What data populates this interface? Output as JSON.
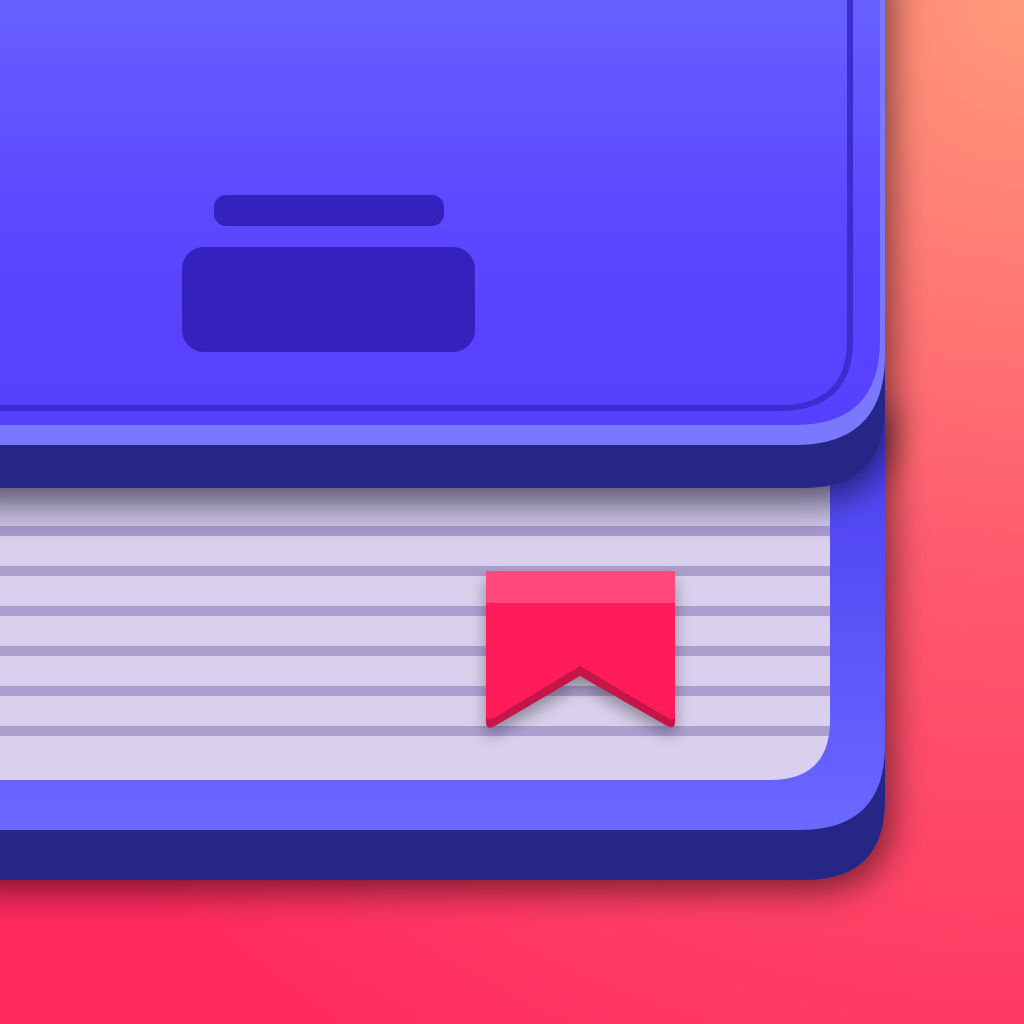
{
  "icon": {
    "subject": "book-with-bookmark-icon",
    "colors": {
      "background_top": "#ff9a7a",
      "background_mid": "#ff5a6e",
      "background_bottom": "#ff2a5e",
      "cover_light": "#6a64ff",
      "cover_main": "#5a46ff",
      "cover_edge": "#7a78ff",
      "cover_dark": "#262686",
      "cover_groove": "#3a2ed0",
      "label_plate": "#3522be",
      "pages_light": "#d8d0ec",
      "pages_line": "#ab9fd0",
      "bookmark": "#ff1e58",
      "bookmark_top": "#ff4a7a",
      "bookmark_shade": "#c4164a"
    }
  }
}
